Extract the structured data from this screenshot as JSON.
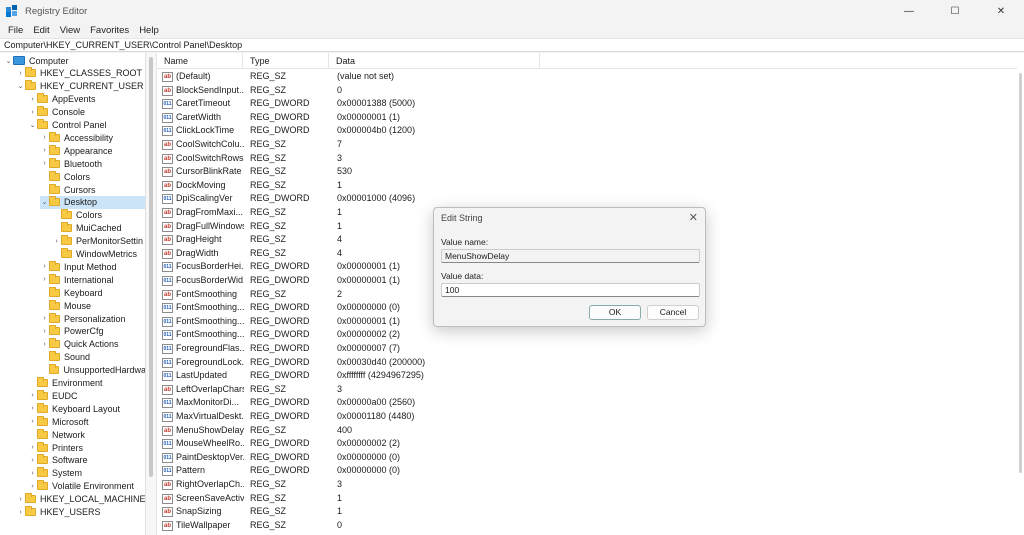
{
  "window": {
    "title": "Registry Editor",
    "controls": {
      "minimize": "—",
      "maximize": "☐",
      "close": "✕"
    }
  },
  "menu": [
    "File",
    "Edit",
    "View",
    "Favorites",
    "Help"
  ],
  "address": "Computer\\HKEY_CURRENT_USER\\Control Panel\\Desktop",
  "tree": [
    {
      "label": "Computer",
      "level": 0,
      "expanded": true,
      "icon": "computer-icon"
    },
    {
      "label": "HKEY_CLASSES_ROOT",
      "level": 1,
      "expanded": false
    },
    {
      "label": "HKEY_CURRENT_USER",
      "level": 1,
      "expanded": true
    },
    {
      "label": "AppEvents",
      "level": 2,
      "expanded": false
    },
    {
      "label": "Console",
      "level": 2,
      "expanded": false
    },
    {
      "label": "Control Panel",
      "level": 2,
      "expanded": true
    },
    {
      "label": "Accessibility",
      "level": 3,
      "expanded": false
    },
    {
      "label": "Appearance",
      "level": 3,
      "expanded": false
    },
    {
      "label": "Bluetooth",
      "level": 3,
      "expanded": false
    },
    {
      "label": "Colors",
      "level": 3,
      "expanded": null
    },
    {
      "label": "Cursors",
      "level": 3,
      "expanded": null
    },
    {
      "label": "Desktop",
      "level": 3,
      "expanded": true,
      "selected": true
    },
    {
      "label": "Colors",
      "level": 4,
      "expanded": null
    },
    {
      "label": "MuiCached",
      "level": 4,
      "expanded": null
    },
    {
      "label": "PerMonitorSettin",
      "level": 4,
      "expanded": false
    },
    {
      "label": "WindowMetrics",
      "level": 4,
      "expanded": null
    },
    {
      "label": "Input Method",
      "level": 3,
      "expanded": false
    },
    {
      "label": "International",
      "level": 3,
      "expanded": false
    },
    {
      "label": "Keyboard",
      "level": 3,
      "expanded": null
    },
    {
      "label": "Mouse",
      "level": 3,
      "expanded": null
    },
    {
      "label": "Personalization",
      "level": 3,
      "expanded": false
    },
    {
      "label": "PowerCfg",
      "level": 3,
      "expanded": false
    },
    {
      "label": "Quick Actions",
      "level": 3,
      "expanded": false
    },
    {
      "label": "Sound",
      "level": 3,
      "expanded": null
    },
    {
      "label": "UnsupportedHardwa",
      "level": 3,
      "expanded": null
    },
    {
      "label": "Environment",
      "level": 2,
      "expanded": null
    },
    {
      "label": "EUDC",
      "level": 2,
      "expanded": false
    },
    {
      "label": "Keyboard Layout",
      "level": 2,
      "expanded": false
    },
    {
      "label": "Microsoft",
      "level": 2,
      "expanded": false
    },
    {
      "label": "Network",
      "level": 2,
      "expanded": null
    },
    {
      "label": "Printers",
      "level": 2,
      "expanded": false
    },
    {
      "label": "Software",
      "level": 2,
      "expanded": false
    },
    {
      "label": "System",
      "level": 2,
      "expanded": false
    },
    {
      "label": "Volatile Environment",
      "level": 2,
      "expanded": false
    },
    {
      "label": "HKEY_LOCAL_MACHINE",
      "level": 1,
      "expanded": false
    },
    {
      "label": "HKEY_USERS",
      "level": 1,
      "expanded": false
    }
  ],
  "list": {
    "headers": [
      "Name",
      "Type",
      "Data"
    ],
    "rows": [
      [
        "(Default)",
        "REG_SZ",
        "(value not set)"
      ],
      [
        "BlockSendInput...",
        "REG_SZ",
        "0"
      ],
      [
        "CaretTimeout",
        "REG_DWORD",
        "0x00001388 (5000)"
      ],
      [
        "CaretWidth",
        "REG_DWORD",
        "0x00000001 (1)"
      ],
      [
        "ClickLockTime",
        "REG_DWORD",
        "0x000004b0 (1200)"
      ],
      [
        "CoolSwitchColu...",
        "REG_SZ",
        "7"
      ],
      [
        "CoolSwitchRows",
        "REG_SZ",
        "3"
      ],
      [
        "CursorBlinkRate",
        "REG_SZ",
        "530"
      ],
      [
        "DockMoving",
        "REG_SZ",
        "1"
      ],
      [
        "DpiScalingVer",
        "REG_DWORD",
        "0x00001000 (4096)"
      ],
      [
        "DragFromMaxi...",
        "REG_SZ",
        "1"
      ],
      [
        "DragFullWindows",
        "REG_SZ",
        "1"
      ],
      [
        "DragHeight",
        "REG_SZ",
        "4"
      ],
      [
        "DragWidth",
        "REG_SZ",
        "4"
      ],
      [
        "FocusBorderHei...",
        "REG_DWORD",
        "0x00000001 (1)"
      ],
      [
        "FocusBorderWid...",
        "REG_DWORD",
        "0x00000001 (1)"
      ],
      [
        "FontSmoothing",
        "REG_SZ",
        "2"
      ],
      [
        "FontSmoothing...",
        "REG_DWORD",
        "0x00000000 (0)"
      ],
      [
        "FontSmoothing...",
        "REG_DWORD",
        "0x00000001 (1)"
      ],
      [
        "FontSmoothing...",
        "REG_DWORD",
        "0x00000002 (2)"
      ],
      [
        "ForegroundFlas...",
        "REG_DWORD",
        "0x00000007 (7)"
      ],
      [
        "ForegroundLock...",
        "REG_DWORD",
        "0x00030d40 (200000)"
      ],
      [
        "LastUpdated",
        "REG_DWORD",
        "0xffffffff (4294967295)"
      ],
      [
        "LeftOverlapChars",
        "REG_SZ",
        "3"
      ],
      [
        "MaxMonitorDi...",
        "REG_DWORD",
        "0x00000a00 (2560)"
      ],
      [
        "MaxVirtualDeskt...",
        "REG_DWORD",
        "0x00001180 (4480)"
      ],
      [
        "MenuShowDelay",
        "REG_SZ",
        "400"
      ],
      [
        "MouseWheelRo...",
        "REG_DWORD",
        "0x00000002 (2)"
      ],
      [
        "PaintDesktopVer...",
        "REG_DWORD",
        "0x00000000 (0)"
      ],
      [
        "Pattern",
        "REG_DWORD",
        "0x00000000 (0)"
      ],
      [
        "RightOverlapCh...",
        "REG_SZ",
        "3"
      ],
      [
        "ScreenSaveActive",
        "REG_SZ",
        "1"
      ],
      [
        "SnapSizing",
        "REG_SZ",
        "1"
      ],
      [
        "TileWallpaper",
        "REG_SZ",
        "0"
      ]
    ]
  },
  "dialog": {
    "title": "Edit String",
    "value_name_label": "Value name:",
    "value_name": "MenuShowDelay",
    "value_data_label": "Value data:",
    "value_data": "100",
    "ok_label": "OK",
    "cancel_label": "Cancel"
  }
}
